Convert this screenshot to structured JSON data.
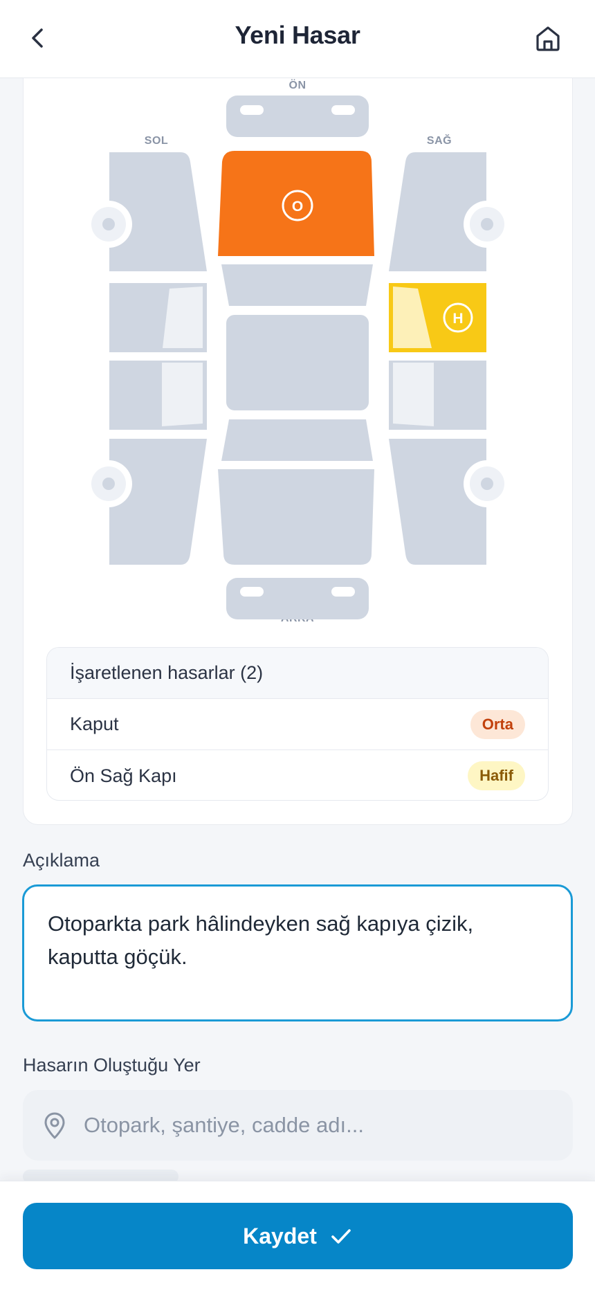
{
  "header": {
    "title": "Yeni Hasar",
    "back_icon": "chevron-left-icon",
    "home_icon": "home-icon"
  },
  "diagram": {
    "labels": {
      "front": "ÖN",
      "back": "ARKA",
      "left": "SOL",
      "right": "SAĞ"
    },
    "parts": [
      {
        "name": "Kaput",
        "badge": "O",
        "severity": "Orta",
        "color": "#f67418"
      },
      {
        "name": "Ön Sağ Kapı",
        "badge": "H",
        "severity": "Hafif",
        "color": "#f8c916"
      }
    ],
    "colors": {
      "panel": "#cfd6e1",
      "glass": "#eef1f5",
      "wheel": "#eef1f6",
      "hub": "#cfd6e1"
    }
  },
  "damage_list": {
    "title": "İşaretlenen hasarlar (2)",
    "items": [
      {
        "part": "Kaput",
        "severity": "Orta"
      },
      {
        "part": "Ön Sağ Kapı",
        "severity": "Hafif"
      }
    ]
  },
  "form": {
    "description_label": "Açıklama",
    "description_value": "Otoparkta park hâlindeyken sağ kapıya çizik, kaputta göçük.",
    "location_label": "Hasarın Oluştuğu Yer",
    "location_placeholder": "Otopark, şantiye, cadde adı...",
    "location_icon": "map-pin-icon"
  },
  "footer": {
    "save_label": "Kaydet",
    "save_icon": "check-icon"
  },
  "colors": {
    "accent": "#0686c8",
    "input_focus": "#1a9ad6",
    "severity_orta_bg": "#fde7d7",
    "severity_orta_text": "#c2410c",
    "severity_hafif_bg": "#fef6c4",
    "severity_hafif_text": "#8a5a06"
  }
}
